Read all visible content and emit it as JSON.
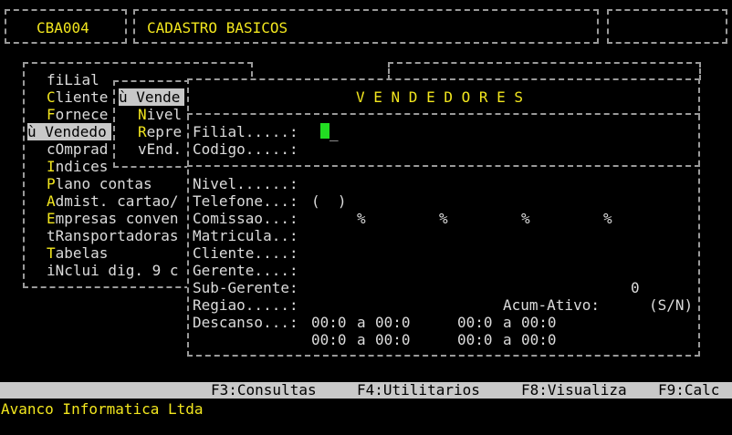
{
  "header": {
    "code": "CBA004",
    "title": "CADASTRO BASICOS"
  },
  "menu": {
    "items": [
      {
        "hot": "",
        "label": "fiLial"
      },
      {
        "hot": "C",
        "label": "liente"
      },
      {
        "hot": "F",
        "label": "ornece"
      },
      {
        "hot": "",
        "label": "ù Vendedo"
      },
      {
        "hot": "",
        "label": "cOmprad"
      },
      {
        "hot": "I",
        "label": "ndices"
      },
      {
        "hot": "P",
        "label": "lano contas"
      },
      {
        "hot": "A",
        "label": "dmist. cartao/"
      },
      {
        "hot": "E",
        "label": "mpresas conven"
      },
      {
        "hot": "",
        "label": "tRansportadoras"
      },
      {
        "hot": "T",
        "label": "abelas"
      },
      {
        "hot": "",
        "label": "iNclui dig. 9 c"
      }
    ]
  },
  "submenu": {
    "items": [
      {
        "label": "ù Vende"
      },
      {
        "hot": "N",
        "label": "ivel"
      },
      {
        "hot": "R",
        "label": "epre"
      },
      {
        "hot": "",
        "label": "vEnd."
      }
    ]
  },
  "form": {
    "title": "V E N D E D O R E S",
    "filial_label": "Filial.....:",
    "codigo_label": "Codigo.....:",
    "nivel_label": "Nivel......:",
    "telefone_label": "Telefone...:",
    "telefone_value": "(  )",
    "comissao_label": "Comissao...:",
    "pct": "%",
    "matricula_label": "Matricula..:",
    "cliente_label": "Cliente....:",
    "gerente_label": "Gerente....:",
    "subgerente_label": "Sub-Gerente:",
    "subgerente_value": "0",
    "regiao_label": "Regiao.....:",
    "acum_label": "Acum-Ativo:",
    "acum_hint": "(S/N)",
    "descanso_label": "Descanso...:",
    "time_from": "00:0",
    "a": "a",
    "time_to": "00:0"
  },
  "footer": {
    "keys": [
      "F3:Consultas",
      "F4:Utilitarios",
      "F8:Visualiza",
      "F9:Calc"
    ],
    "company": "Avanco Informatica Ltda"
  },
  "colors": {
    "accent": "#f2e61e",
    "bar": "#c9c9c9",
    "cursor": "#22dd22"
  }
}
